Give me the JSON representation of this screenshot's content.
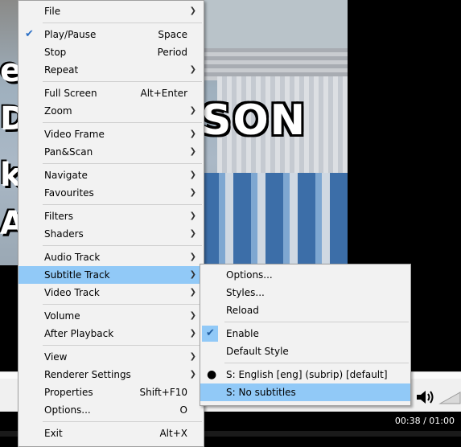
{
  "main_menu": {
    "items": [
      {
        "label": "File",
        "shortcut": "",
        "arrow": true
      },
      {
        "sep": true
      },
      {
        "label": "Play/Pause",
        "shortcut": "Space",
        "checked": true
      },
      {
        "label": "Stop",
        "shortcut": "Period"
      },
      {
        "label": "Repeat",
        "shortcut": "",
        "arrow": true
      },
      {
        "sep": true
      },
      {
        "label": "Full Screen",
        "shortcut": "Alt+Enter"
      },
      {
        "label": "Zoom",
        "shortcut": "",
        "arrow": true
      },
      {
        "sep": true
      },
      {
        "label": "Video Frame",
        "shortcut": "",
        "arrow": true
      },
      {
        "label": "Pan&Scan",
        "shortcut": "",
        "arrow": true
      },
      {
        "sep": true
      },
      {
        "label": "Navigate",
        "shortcut": "",
        "arrow": true
      },
      {
        "label": "Favourites",
        "shortcut": "",
        "arrow": true
      },
      {
        "sep": true
      },
      {
        "label": "Filters",
        "shortcut": "",
        "arrow": true
      },
      {
        "label": "Shaders",
        "shortcut": "",
        "arrow": true
      },
      {
        "sep": true
      },
      {
        "label": "Audio Track",
        "shortcut": "",
        "arrow": true
      },
      {
        "label": "Subtitle Track",
        "shortcut": "",
        "arrow": true,
        "highlighted": true
      },
      {
        "label": "Video Track",
        "shortcut": "",
        "arrow": true
      },
      {
        "sep": true
      },
      {
        "label": "Volume",
        "shortcut": "",
        "arrow": true
      },
      {
        "label": "After Playback",
        "shortcut": "",
        "arrow": true
      },
      {
        "sep": true
      },
      {
        "label": "View",
        "shortcut": "",
        "arrow": true
      },
      {
        "label": "Renderer Settings",
        "shortcut": "",
        "arrow": true
      },
      {
        "label": "Properties",
        "shortcut": "Shift+F10"
      },
      {
        "label": "Options...",
        "shortcut": "O"
      },
      {
        "sep": true
      },
      {
        "label": "Exit",
        "shortcut": "Alt+X"
      }
    ]
  },
  "subtitle_menu": {
    "items": [
      {
        "label": "Options..."
      },
      {
        "label": "Styles..."
      },
      {
        "label": "Reload"
      },
      {
        "sep": true
      },
      {
        "label": "Enable",
        "checked": true
      },
      {
        "label": "Default Style"
      },
      {
        "sep": true
      },
      {
        "label": "S: English [eng] (subrip) [default]",
        "radio": true
      },
      {
        "label": "S: No subtitles",
        "highlighted": true
      }
    ]
  },
  "video": {
    "overlay_text": "SON",
    "left_chars": [
      "e",
      "D",
      "k",
      "A"
    ]
  },
  "status": {
    "timecode": "00:38 / 01:00"
  },
  "colors": {
    "highlight": "#91c9f7",
    "menu_bg": "#f2f2f2"
  }
}
